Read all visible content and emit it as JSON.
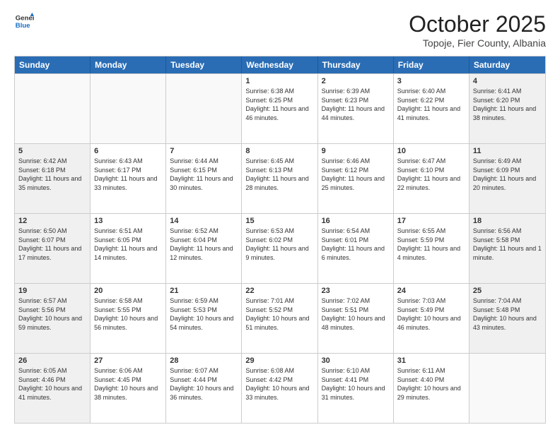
{
  "header": {
    "logo_general": "General",
    "logo_blue": "Blue",
    "month": "October 2025",
    "location": "Topoje, Fier County, Albania"
  },
  "weekdays": [
    "Sunday",
    "Monday",
    "Tuesday",
    "Wednesday",
    "Thursday",
    "Friday",
    "Saturday"
  ],
  "rows": [
    [
      {
        "day": "",
        "text": "",
        "empty": true
      },
      {
        "day": "",
        "text": "",
        "empty": true
      },
      {
        "day": "",
        "text": "",
        "empty": true
      },
      {
        "day": "1",
        "text": "Sunrise: 6:38 AM\nSunset: 6:25 PM\nDaylight: 11 hours and 46 minutes.",
        "empty": false
      },
      {
        "day": "2",
        "text": "Sunrise: 6:39 AM\nSunset: 6:23 PM\nDaylight: 11 hours and 44 minutes.",
        "empty": false
      },
      {
        "day": "3",
        "text": "Sunrise: 6:40 AM\nSunset: 6:22 PM\nDaylight: 11 hours and 41 minutes.",
        "empty": false
      },
      {
        "day": "4",
        "text": "Sunrise: 6:41 AM\nSunset: 6:20 PM\nDaylight: 11 hours and 38 minutes.",
        "empty": false
      }
    ],
    [
      {
        "day": "5",
        "text": "Sunrise: 6:42 AM\nSunset: 6:18 PM\nDaylight: 11 hours and 35 minutes.",
        "empty": false
      },
      {
        "day": "6",
        "text": "Sunrise: 6:43 AM\nSunset: 6:17 PM\nDaylight: 11 hours and 33 minutes.",
        "empty": false
      },
      {
        "day": "7",
        "text": "Sunrise: 6:44 AM\nSunset: 6:15 PM\nDaylight: 11 hours and 30 minutes.",
        "empty": false
      },
      {
        "day": "8",
        "text": "Sunrise: 6:45 AM\nSunset: 6:13 PM\nDaylight: 11 hours and 28 minutes.",
        "empty": false
      },
      {
        "day": "9",
        "text": "Sunrise: 6:46 AM\nSunset: 6:12 PM\nDaylight: 11 hours and 25 minutes.",
        "empty": false
      },
      {
        "day": "10",
        "text": "Sunrise: 6:47 AM\nSunset: 6:10 PM\nDaylight: 11 hours and 22 minutes.",
        "empty": false
      },
      {
        "day": "11",
        "text": "Sunrise: 6:49 AM\nSunset: 6:09 PM\nDaylight: 11 hours and 20 minutes.",
        "empty": false
      }
    ],
    [
      {
        "day": "12",
        "text": "Sunrise: 6:50 AM\nSunset: 6:07 PM\nDaylight: 11 hours and 17 minutes.",
        "empty": false
      },
      {
        "day": "13",
        "text": "Sunrise: 6:51 AM\nSunset: 6:05 PM\nDaylight: 11 hours and 14 minutes.",
        "empty": false
      },
      {
        "day": "14",
        "text": "Sunrise: 6:52 AM\nSunset: 6:04 PM\nDaylight: 11 hours and 12 minutes.",
        "empty": false
      },
      {
        "day": "15",
        "text": "Sunrise: 6:53 AM\nSunset: 6:02 PM\nDaylight: 11 hours and 9 minutes.",
        "empty": false
      },
      {
        "day": "16",
        "text": "Sunrise: 6:54 AM\nSunset: 6:01 PM\nDaylight: 11 hours and 6 minutes.",
        "empty": false
      },
      {
        "day": "17",
        "text": "Sunrise: 6:55 AM\nSunset: 5:59 PM\nDaylight: 11 hours and 4 minutes.",
        "empty": false
      },
      {
        "day": "18",
        "text": "Sunrise: 6:56 AM\nSunset: 5:58 PM\nDaylight: 11 hours and 1 minute.",
        "empty": false
      }
    ],
    [
      {
        "day": "19",
        "text": "Sunrise: 6:57 AM\nSunset: 5:56 PM\nDaylight: 10 hours and 59 minutes.",
        "empty": false
      },
      {
        "day": "20",
        "text": "Sunrise: 6:58 AM\nSunset: 5:55 PM\nDaylight: 10 hours and 56 minutes.",
        "empty": false
      },
      {
        "day": "21",
        "text": "Sunrise: 6:59 AM\nSunset: 5:53 PM\nDaylight: 10 hours and 54 minutes.",
        "empty": false
      },
      {
        "day": "22",
        "text": "Sunrise: 7:01 AM\nSunset: 5:52 PM\nDaylight: 10 hours and 51 minutes.",
        "empty": false
      },
      {
        "day": "23",
        "text": "Sunrise: 7:02 AM\nSunset: 5:51 PM\nDaylight: 10 hours and 48 minutes.",
        "empty": false
      },
      {
        "day": "24",
        "text": "Sunrise: 7:03 AM\nSunset: 5:49 PM\nDaylight: 10 hours and 46 minutes.",
        "empty": false
      },
      {
        "day": "25",
        "text": "Sunrise: 7:04 AM\nSunset: 5:48 PM\nDaylight: 10 hours and 43 minutes.",
        "empty": false
      }
    ],
    [
      {
        "day": "26",
        "text": "Sunrise: 6:05 AM\nSunset: 4:46 PM\nDaylight: 10 hours and 41 minutes.",
        "empty": false
      },
      {
        "day": "27",
        "text": "Sunrise: 6:06 AM\nSunset: 4:45 PM\nDaylight: 10 hours and 38 minutes.",
        "empty": false
      },
      {
        "day": "28",
        "text": "Sunrise: 6:07 AM\nSunset: 4:44 PM\nDaylight: 10 hours and 36 minutes.",
        "empty": false
      },
      {
        "day": "29",
        "text": "Sunrise: 6:08 AM\nSunset: 4:42 PM\nDaylight: 10 hours and 33 minutes.",
        "empty": false
      },
      {
        "day": "30",
        "text": "Sunrise: 6:10 AM\nSunset: 4:41 PM\nDaylight: 10 hours and 31 minutes.",
        "empty": false
      },
      {
        "day": "31",
        "text": "Sunrise: 6:11 AM\nSunset: 4:40 PM\nDaylight: 10 hours and 29 minutes.",
        "empty": false
      },
      {
        "day": "",
        "text": "",
        "empty": true
      }
    ]
  ]
}
